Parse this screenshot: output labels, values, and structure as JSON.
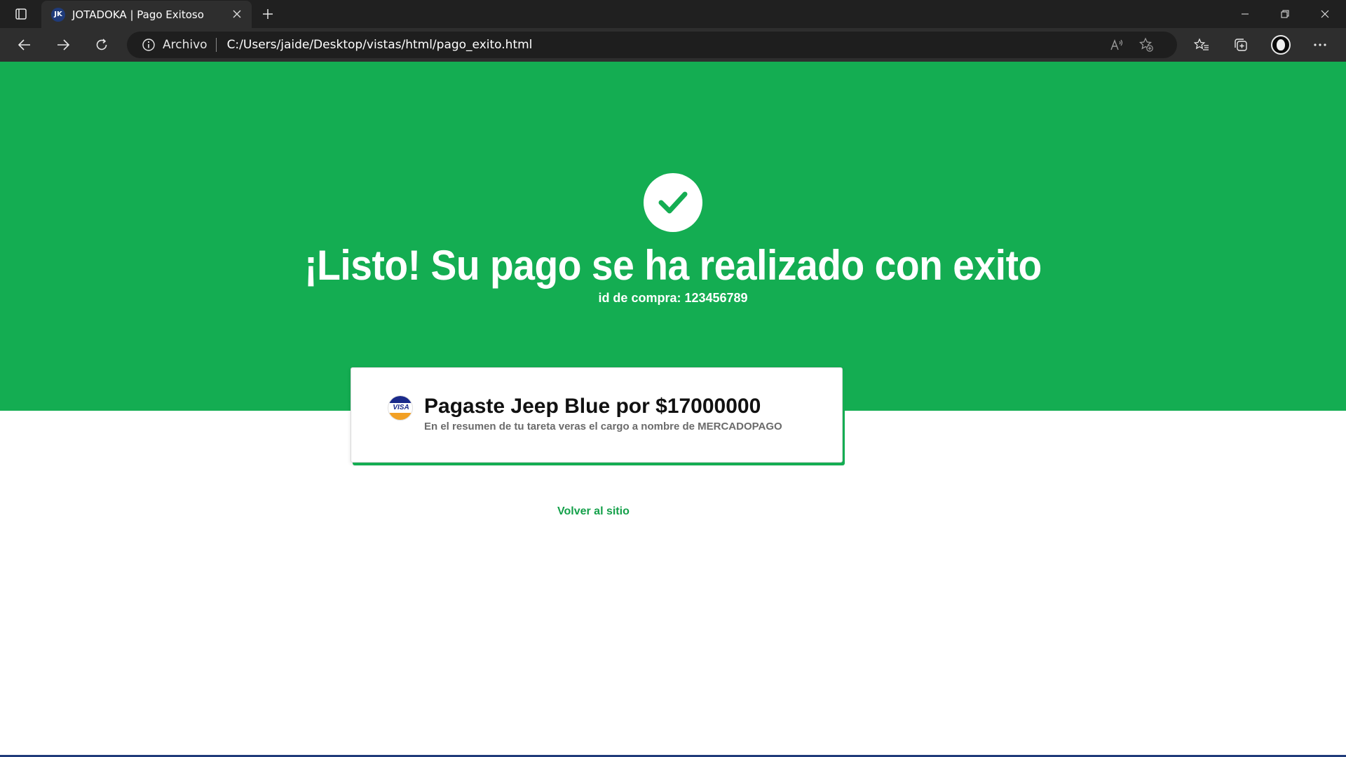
{
  "browser": {
    "tab": {
      "favicon_text": "JK",
      "title": "JOTADOKA | Pago Exitoso"
    },
    "address": {
      "scheme_label": "Archivo",
      "url": "C:/Users/jaide/Desktop/vistas/html/pago_exito.html"
    },
    "icons": {
      "tab_actions": "tab-actions-icon",
      "close_tab": "close-icon",
      "new_tab": "plus-icon",
      "back": "arrow-left-icon",
      "forward": "arrow-right-icon",
      "reload": "reload-icon",
      "info": "info-icon",
      "read_aloud": "read-aloud-icon",
      "add_favorite": "star-plus-icon",
      "favorites": "favorites-icon",
      "collections": "collections-icon",
      "more": "more-icon"
    }
  },
  "hero": {
    "title": "¡Listo! Su pago se ha realizado con exito",
    "purchase_id": "id de compra: 123456789",
    "icon": "checkmark-icon"
  },
  "card": {
    "brand_badge": "VISA",
    "title": "Pagaste Jeep Blue por $17000000",
    "subtitle": "En el resumen de tu tareta veras el cargo a nombre de MERCADOPAGO"
  },
  "back_link": "Volver al sitio",
  "colors": {
    "brand_green": "#14ad52",
    "link_green": "#14a04a",
    "chrome_dark": "#202020",
    "chrome_toolbar": "#2e2e2e",
    "visa_blue": "#1a2a8a",
    "visa_gold": "#f2a024"
  }
}
